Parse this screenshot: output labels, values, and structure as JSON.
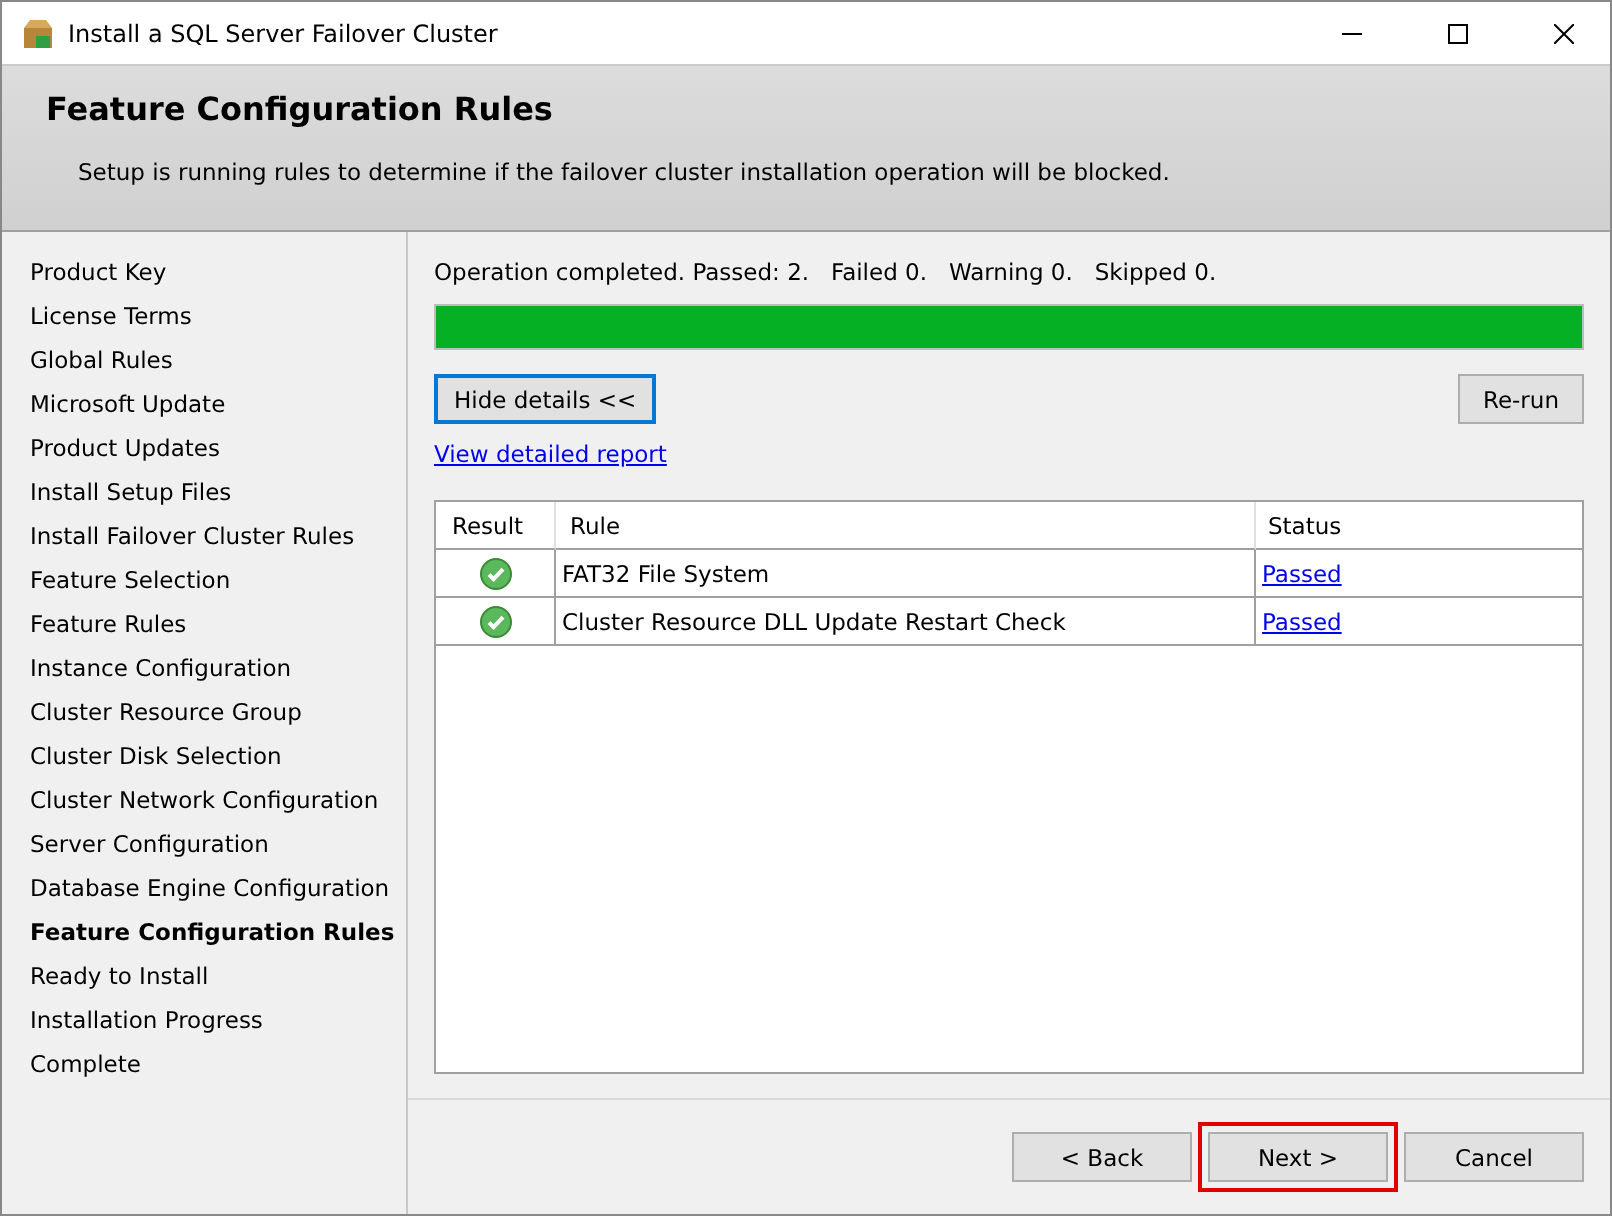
{
  "window": {
    "title": "Install a SQL Server Failover Cluster"
  },
  "header": {
    "title": "Feature Configuration Rules",
    "description": "Setup is running rules to determine if the failover cluster installation operation will be blocked."
  },
  "sidebar": {
    "items": [
      {
        "label": "Product Key",
        "selected": false
      },
      {
        "label": "License Terms",
        "selected": false
      },
      {
        "label": "Global Rules",
        "selected": false
      },
      {
        "label": "Microsoft Update",
        "selected": false
      },
      {
        "label": "Product Updates",
        "selected": false
      },
      {
        "label": "Install Setup Files",
        "selected": false
      },
      {
        "label": "Install Failover Cluster Rules",
        "selected": false
      },
      {
        "label": "Feature Selection",
        "selected": false
      },
      {
        "label": "Feature Rules",
        "selected": false
      },
      {
        "label": "Instance Configuration",
        "selected": false
      },
      {
        "label": "Cluster Resource Group",
        "selected": false
      },
      {
        "label": "Cluster Disk Selection",
        "selected": false
      },
      {
        "label": "Cluster Network Configuration",
        "selected": false
      },
      {
        "label": "Server Configuration",
        "selected": false
      },
      {
        "label": "Database Engine Configuration",
        "selected": false
      },
      {
        "label": "Feature Configuration Rules",
        "selected": true
      },
      {
        "label": "Ready to Install",
        "selected": false
      },
      {
        "label": "Installation Progress",
        "selected": false
      },
      {
        "label": "Complete",
        "selected": false
      }
    ]
  },
  "status": "Operation completed. Passed: 2.   Failed 0.   Warning 0.   Skipped 0.",
  "progress": {
    "level": 1
  },
  "hide_details_button": "Hide details <<",
  "rerun_button": "Re-run",
  "report_link": "View detailed report",
  "table": {
    "columns": [
      "Result",
      "Rule",
      "Status"
    ],
    "rows": [
      {
        "kind": "passed",
        "rule": "FAT32 File System",
        "status": "Passed"
      },
      {
        "kind": "passed",
        "rule": "Cluster Resource DLL Update Restart Check",
        "status": "Passed"
      }
    ]
  },
  "footer_buttons": [
    {
      "label": "< Back",
      "highlighted": false
    },
    {
      "label": "Next >",
      "highlighted": true
    },
    {
      "label": "Cancel",
      "highlighted": false
    }
  ]
}
